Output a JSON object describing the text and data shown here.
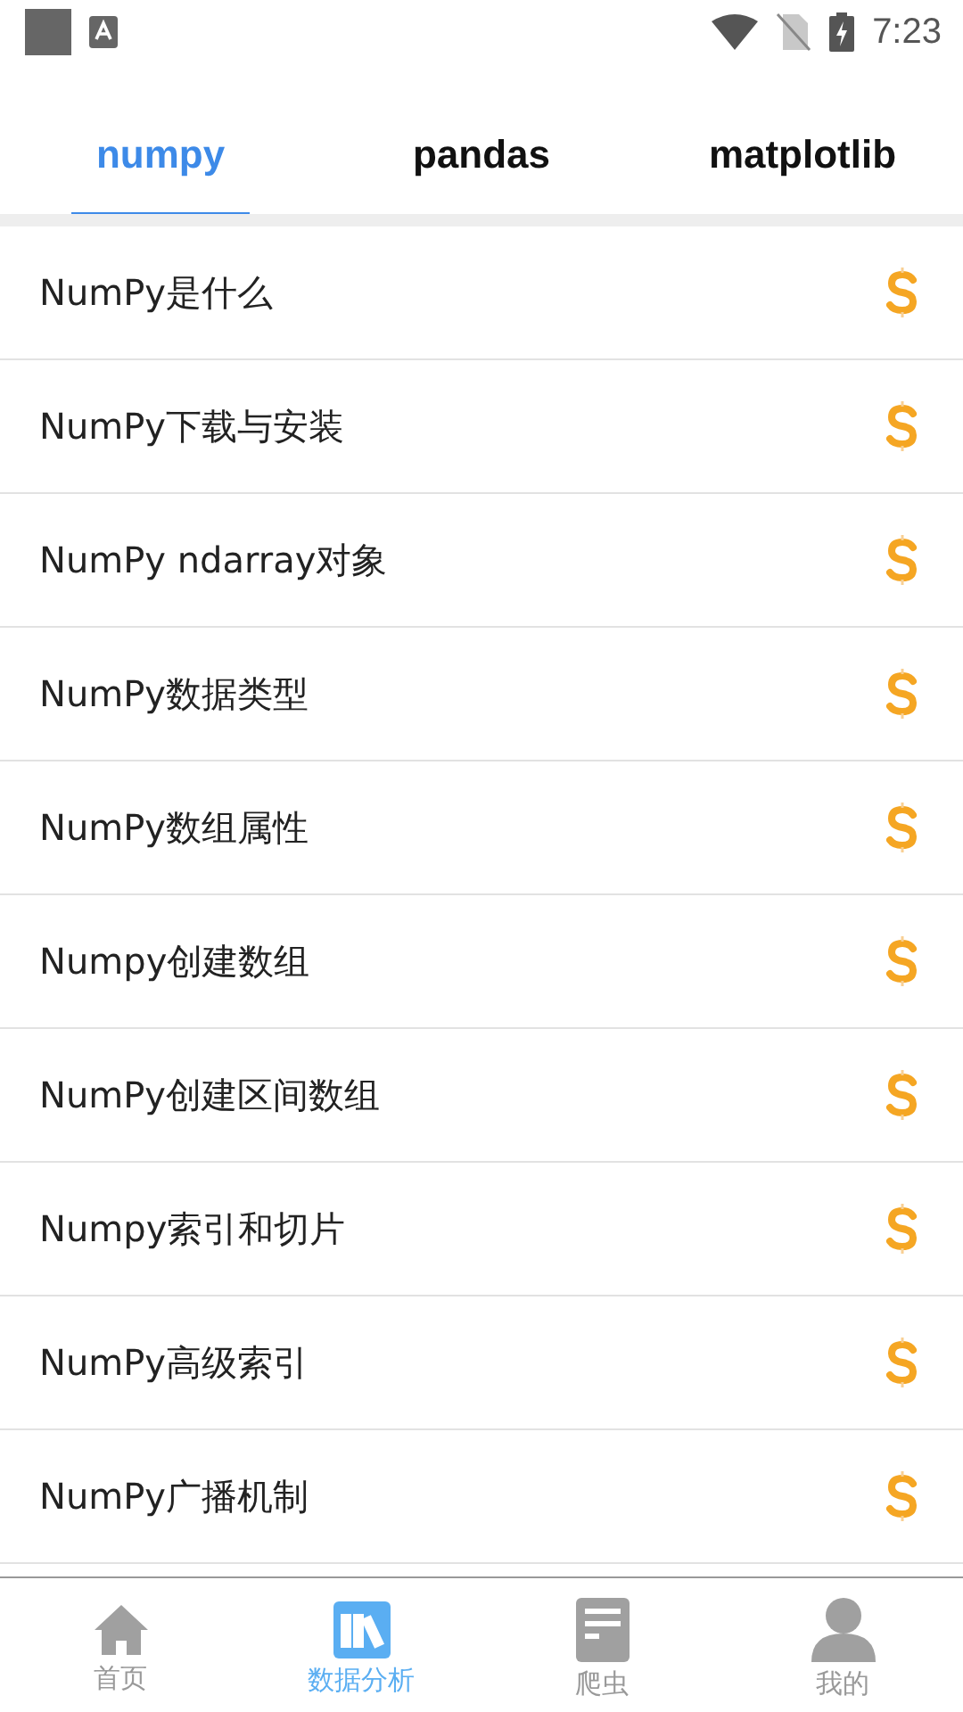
{
  "status_bar": {
    "time": "7:23"
  },
  "tabs": [
    {
      "label": "numpy",
      "selected": true
    },
    {
      "label": "pandas",
      "selected": false
    },
    {
      "label": "matplotlib",
      "selected": false
    }
  ],
  "lessons": [
    {
      "title": "NumPy是什么"
    },
    {
      "title": "NumPy下载与安装"
    },
    {
      "title": "NumPy ndarray对象"
    },
    {
      "title": "NumPy数据类型"
    },
    {
      "title": "NumPy数组属性"
    },
    {
      "title": "Numpy创建数组"
    },
    {
      "title": "NumPy创建区间数组"
    },
    {
      "title": "Numpy索引和切片"
    },
    {
      "title": "NumPy高级索引"
    },
    {
      "title": "NumPy广播机制"
    }
  ],
  "bottom_nav": [
    {
      "label": "首页",
      "kind": "home",
      "selected": false
    },
    {
      "label": "数据分析",
      "kind": "books",
      "selected": true
    },
    {
      "label": "爬虫",
      "kind": "document",
      "selected": false
    },
    {
      "label": "我的",
      "kind": "person",
      "selected": false
    }
  ]
}
